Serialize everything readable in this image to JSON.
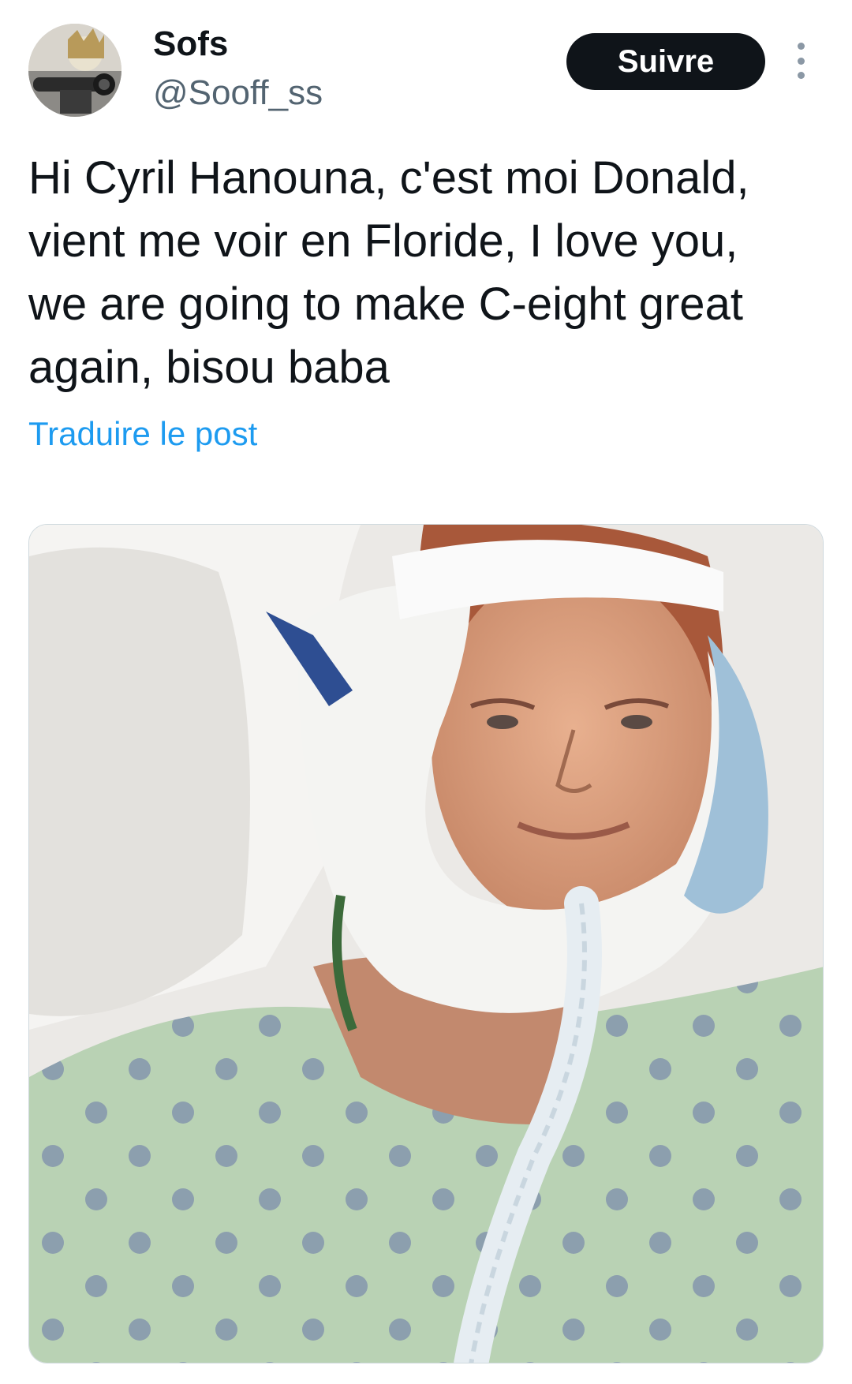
{
  "post": {
    "author": {
      "display_name": "Sofs",
      "handle": "@Sooff_ss",
      "avatar_icon": "avatar-photo"
    },
    "follow_label": "Suivre",
    "more_icon": "more-vertical-icon",
    "text": "Hi Cyril Hanouna, c'est moi Donald,\nvient me voir en Floride, I love you,\nwe are going to make C-eight great\nagain, bisou baba",
    "translate_label": "Traduire le post",
    "media": {
      "kind": "photo",
      "icon": "post-image"
    }
  },
  "colors": {
    "text": "#0f1419",
    "secondary": "#536471",
    "link": "#1d9bf0",
    "button_bg": "#0f1419",
    "button_text": "#ffffff"
  }
}
